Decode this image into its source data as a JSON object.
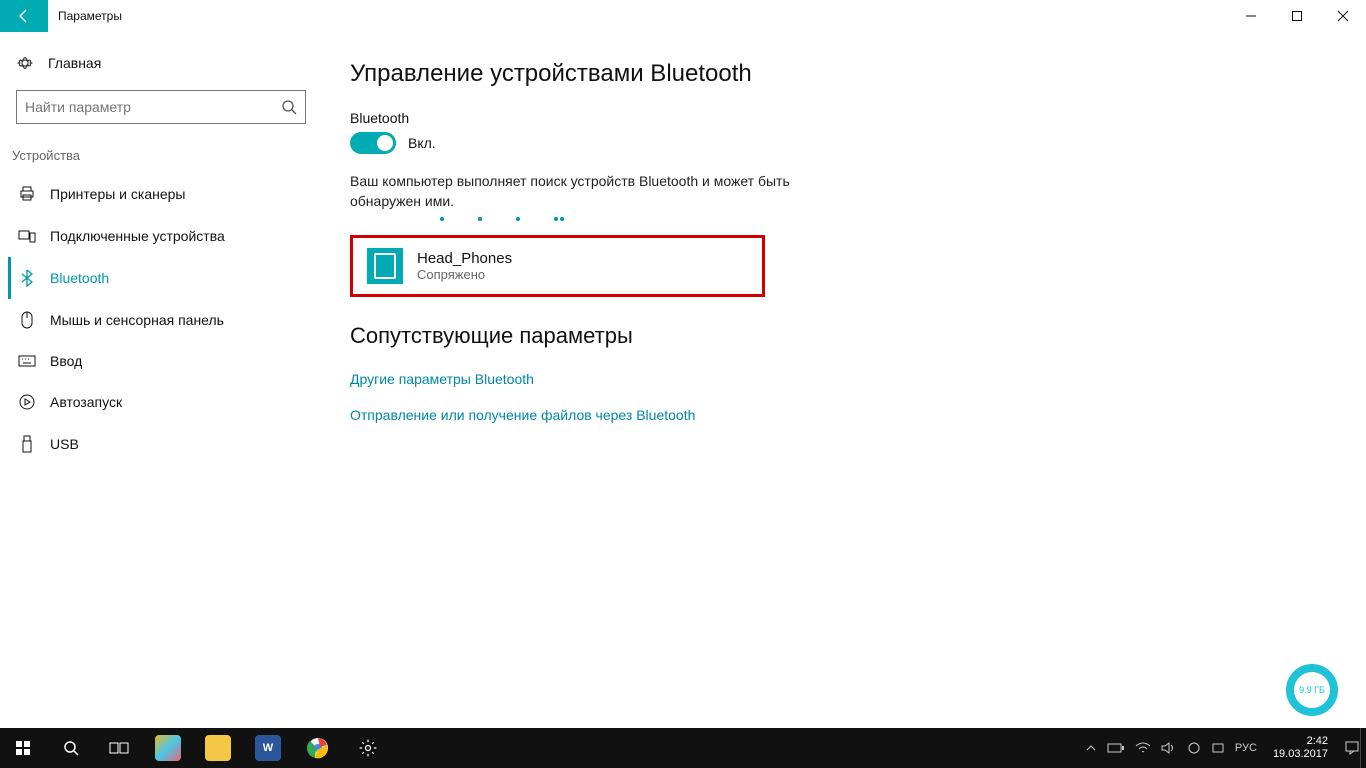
{
  "window": {
    "title": "Параметры"
  },
  "sidebar": {
    "home": "Главная",
    "search_placeholder": "Найти параметр",
    "section": "Устройства",
    "items": [
      {
        "label": "Принтеры и сканеры",
        "icon": "printers"
      },
      {
        "label": "Подключенные устройства",
        "icon": "devices"
      },
      {
        "label": "Bluetooth",
        "icon": "bluetooth"
      },
      {
        "label": "Мышь и сенсорная панель",
        "icon": "mouse"
      },
      {
        "label": "Ввод",
        "icon": "keyboard"
      },
      {
        "label": "Автозапуск",
        "icon": "autoplay"
      },
      {
        "label": "USB",
        "icon": "usb"
      }
    ]
  },
  "main": {
    "heading": "Управление устройствами Bluetooth",
    "bluetooth_label": "Bluetooth",
    "toggle_state": "Вкл.",
    "search_line": "Ваш компьютер выполняет поиск устройств Bluetooth и может быть обнаружен ими.",
    "device": {
      "name": "Head_Phones",
      "status": "Сопряжено"
    },
    "related_heading": "Сопутствующие параметры",
    "link1": "Другие параметры Bluetooth",
    "link2": "Отправление или получение файлов через Bluetooth"
  },
  "badge": "9.9 ГБ",
  "tray": {
    "lang": "РУС",
    "time": "2:42",
    "date": "19.03.2017"
  }
}
